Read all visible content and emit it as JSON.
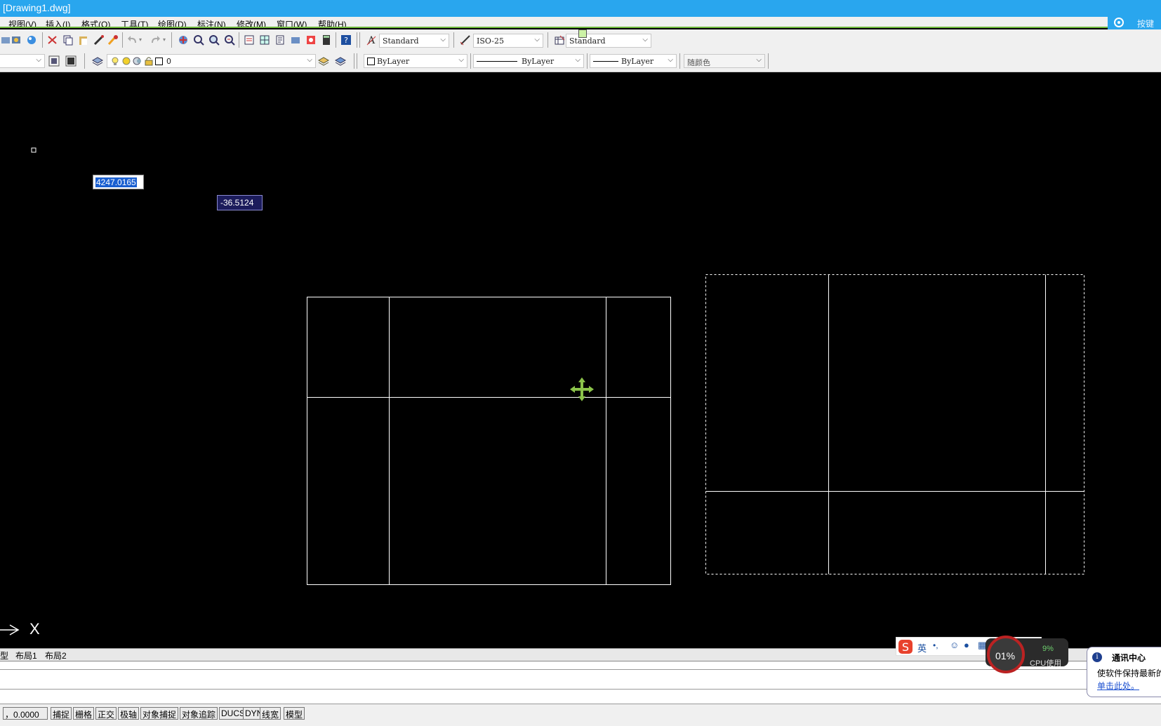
{
  "window": {
    "title": "[Drawing1.dwg]"
  },
  "menu": {
    "items": [
      "视图(V)",
      "插入(I)",
      "格式(O)",
      "工具(T)",
      "绘图(D)",
      "标注(N)",
      "修改(M)",
      "窗口(W)",
      "帮助(H)"
    ]
  },
  "help_search": {
    "label": "按键"
  },
  "toolbar1": {
    "text_style": "Standard",
    "dim_style": "ISO-25",
    "table_style": "Standard"
  },
  "toolbar2": {
    "layer_name": "0",
    "color": "ByLayer",
    "linetype": "ByLayer",
    "lineweight": "ByLayer",
    "plot_style": "随颜色"
  },
  "dynamic_input": {
    "distance": "4247.0165",
    "angle": "-36.5124"
  },
  "ucs": {
    "y_label": "X"
  },
  "layout_tabs": [
    "型",
    "布局1",
    "布局2"
  ],
  "status": {
    "coordinates": "，0.0000",
    "toggles": [
      "捕捉",
      "栅格",
      "正交",
      "极轴",
      "对象捕捉",
      "对象追踪",
      "DUCS",
      "DYN",
      "线宽",
      "模型"
    ]
  },
  "ime": {
    "lang": "英"
  },
  "cpu": {
    "percent": "01%",
    "secondary": "9%",
    "label": "CPU使用"
  },
  "notification": {
    "title": "通讯中心",
    "body": "使软件保持最新的",
    "link": "单击此处。"
  },
  "colors": {
    "titlebar": "#29a6ee",
    "canvas": "#000000",
    "grip": "#8bc34a",
    "geometry": "#ffffff"
  }
}
